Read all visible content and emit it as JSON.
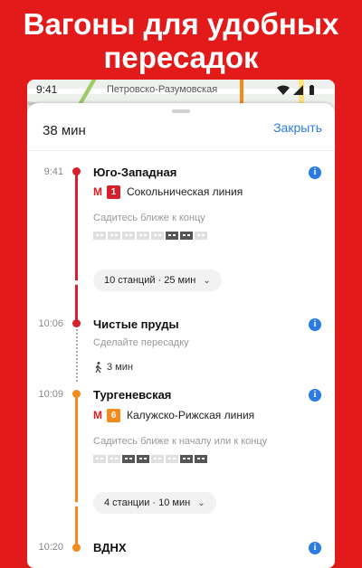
{
  "headline": [
    "Вагоны для удобных",
    "пересадок"
  ],
  "status": {
    "time": "9:41",
    "street": "Петровско-Разумовская"
  },
  "sheet": {
    "duration": "38 мин",
    "close_label": "Закрыть"
  },
  "metro_symbol": "М",
  "stops": [
    {
      "time": "9:41",
      "name": "Юго-Западная",
      "line_number": "1",
      "line_name": "Сокольническая линия",
      "line_color": "#d7202c",
      "hint": "Садитесь ближе к концу"
    },
    {
      "time": "10:06",
      "name": "Чистые пруды",
      "hint": "Сделайте пересадку",
      "walk": "3 мин"
    },
    {
      "time": "10:09",
      "name": "Тургеневская",
      "line_number": "6",
      "line_name": "Калужско-Рижская линия",
      "line_color": "#f28a1c",
      "hint": "Садитесь ближе к началу или к концу"
    },
    {
      "time": "10:20",
      "name": "ВДНХ"
    }
  ],
  "segments": [
    {
      "label": "10 станций · 25 мин"
    },
    {
      "label": "4 станции · 10 мин"
    }
  ]
}
